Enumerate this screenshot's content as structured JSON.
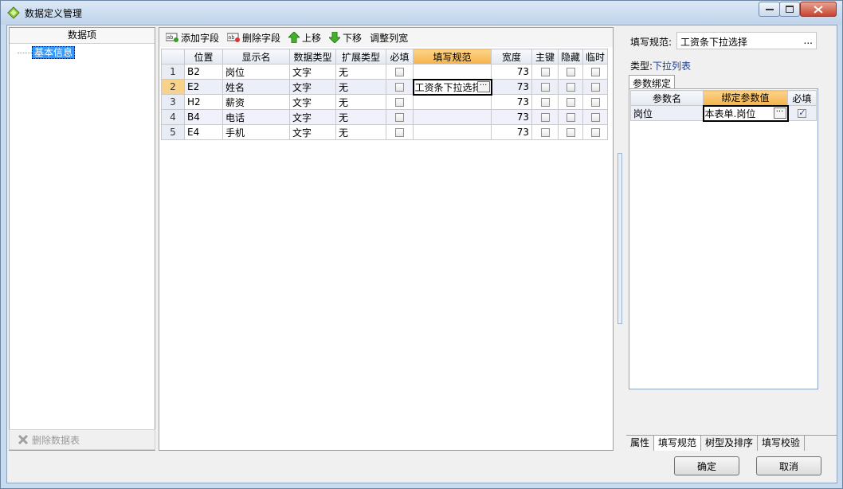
{
  "window": {
    "title": "数据定义管理",
    "title_icon": "diamond-app-icon"
  },
  "left": {
    "header": "数据项",
    "tree": [
      {
        "label": "基本信息",
        "selected": true
      }
    ],
    "delete_button": "删除数据表"
  },
  "toolbar": {
    "add_field": "添加字段",
    "delete_field": "删除字段",
    "move_up": "上移",
    "move_down": "下移",
    "adjust_width": "调整列宽"
  },
  "grid": {
    "columns": [
      "",
      "位置",
      "显示名",
      "数据类型",
      "扩展类型",
      "必填",
      "填写规范",
      "宽度",
      "主键",
      "隐藏",
      "临时"
    ],
    "rows": [
      {
        "no": "1",
        "pos": "B2",
        "name": "岗位",
        "type": "文字",
        "ext": "无",
        "rule": "",
        "width": "73"
      },
      {
        "no": "2",
        "pos": "E2",
        "name": "姓名",
        "type": "文字",
        "ext": "无",
        "rule": "工资条下拉选择",
        "width": "73"
      },
      {
        "no": "3",
        "pos": "H2",
        "name": "薪资",
        "type": "文字",
        "ext": "无",
        "rule": "",
        "width": "73"
      },
      {
        "no": "4",
        "pos": "B4",
        "name": "电话",
        "type": "文字",
        "ext": "无",
        "rule": "",
        "width": "73"
      },
      {
        "no": "5",
        "pos": "E4",
        "name": "手机",
        "type": "文字",
        "ext": "无",
        "rule": "",
        "width": "73"
      }
    ]
  },
  "right": {
    "rule_label": "填写规范:",
    "rule_value": "工资条下拉选择",
    "rule_button": "...",
    "type_label": "类型:",
    "type_value": "下拉列表",
    "tab": "参数绑定",
    "param_columns": [
      "参数名",
      "绑定参数值",
      "必填"
    ],
    "params": [
      {
        "name": "岗位",
        "value": "本表单.岗位",
        "required": true
      }
    ],
    "bottom_tabs": [
      "属性",
      "填写规范",
      "树型及排序",
      "填写校验"
    ]
  },
  "buttons": {
    "ok": "确定",
    "cancel": "取消"
  },
  "colors": {
    "selected_header": "#f5b24a",
    "tree_selection": "#3399ff"
  }
}
